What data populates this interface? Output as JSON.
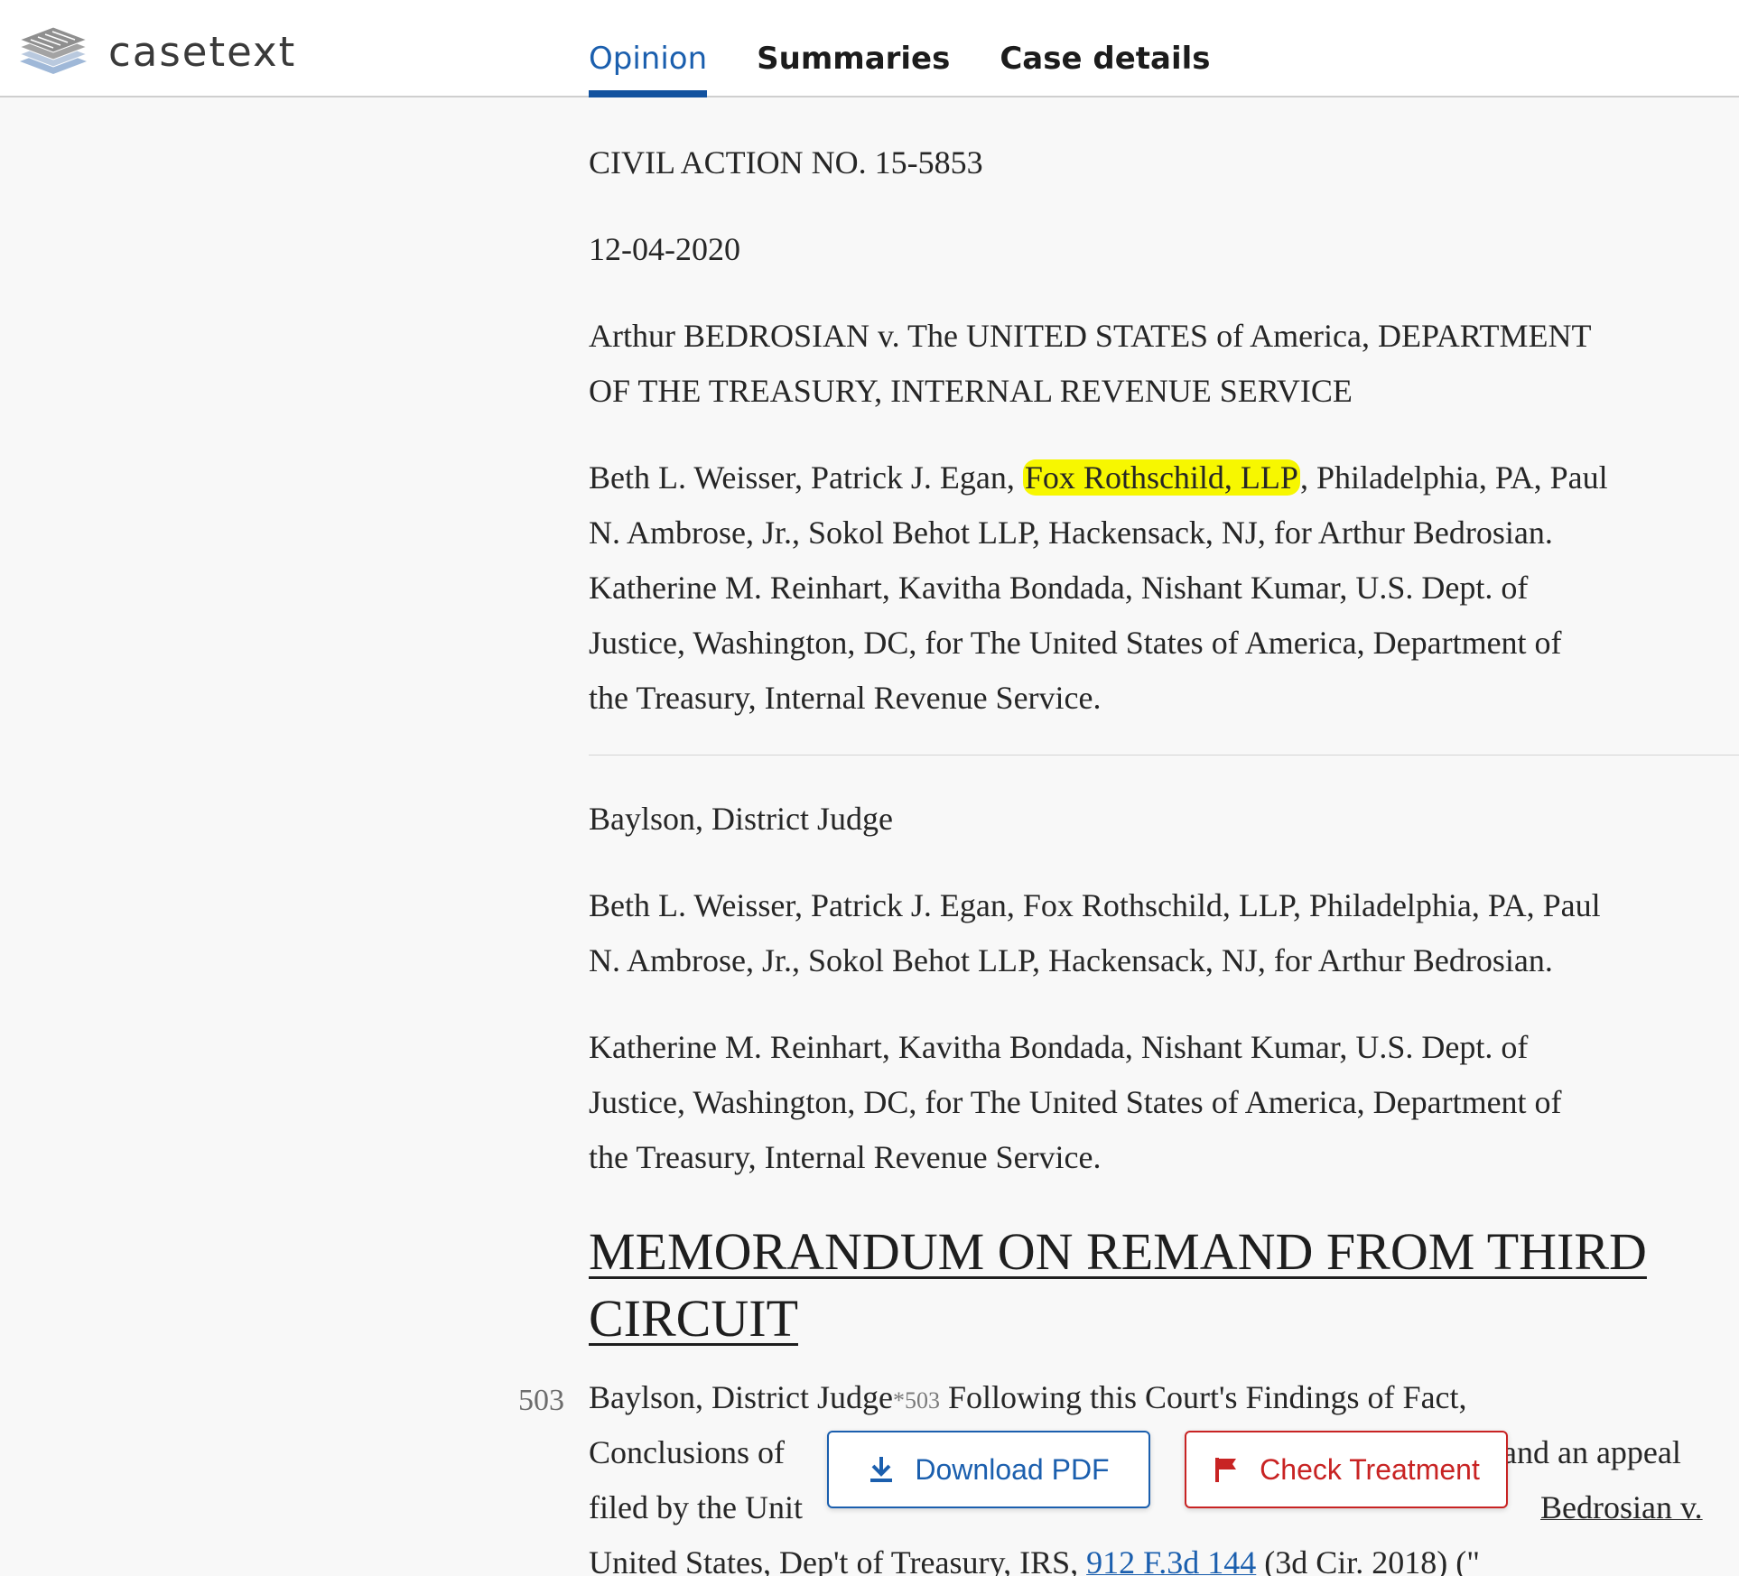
{
  "header": {
    "logo_text": "casetext",
    "tabs": [
      {
        "label": "Opinion",
        "active": true
      },
      {
        "label": "Summaries",
        "active": false
      },
      {
        "label": "Case details",
        "active": false
      }
    ]
  },
  "doc": {
    "civil_action": "CIVIL ACTION NO. 15-5853",
    "date": "12-04-2020",
    "caption_line1": "Arthur BEDROSIAN v. The UNITED STATES of America, DEPARTMENT",
    "caption_line2": "OF THE TREASURY, INTERNAL REVENUE SERVICE",
    "counsel1_pre": "Beth L. Weisser, Patrick J. Egan, ",
    "counsel1_hl": "Fox Rothschild, LLP",
    "counsel1_post": ", Philadelphia, PA, Paul",
    "counsel1_l2": "N. Ambrose, Jr., Sokol Behot LLP, Hackensack, NJ, for Arthur Bedrosian.",
    "counsel1_l3": "Katherine M. Reinhart, Kavitha Bondada, Nishant Kumar, U.S. Dept. of",
    "counsel1_l4": "Justice, Washington, DC, for The United States of America, Department of",
    "counsel1_l5": "the Treasury, Internal Revenue Service.",
    "judge": "Baylson, District Judge",
    "counsel2_l1": "Beth L. Weisser, Patrick J. Egan, Fox Rothschild, LLP, Philadelphia, PA, Paul",
    "counsel2_l2": "N. Ambrose, Jr., Sokol Behot LLP, Hackensack, NJ, for Arthur Bedrosian.",
    "counsel3_l1": "Katherine M. Reinhart, Kavitha Bondada, Nishant Kumar, U.S. Dept. of",
    "counsel3_l2": "Justice, Washington, DC, for The United States of America, Department of",
    "counsel3_l3": "the Treasury, Internal Revenue Service.",
    "heading_l1": "MEMORANDUM ON REMAND FROM THIRD",
    "heading_l2": "CIRCUIT",
    "page_number": "503",
    "body_l1_judge": "Baylson, District Judge",
    "body_l1_star": "*503",
    "body_l1_rest": " Following this Court's Findings of Fact,",
    "body_l2_a": "Conclusions of",
    "body_l2_b": "and an appeal",
    "body_l3_a": "filed by the Unit",
    "body_l3_cite": "Bedrosian v.",
    "body_l4_a": "United States, Dep't of Treasury, IRS,",
    "body_l4_link": "912 F.3d 144",
    "body_l4_b": " (3d Cir. 2018) (\""
  },
  "actions": {
    "download_pdf": "Download PDF",
    "check_treatment": "Check Treatment"
  },
  "colors": {
    "accent": "#1b5fae",
    "treatment": "#c82323",
    "highlight": "#f7f700"
  }
}
